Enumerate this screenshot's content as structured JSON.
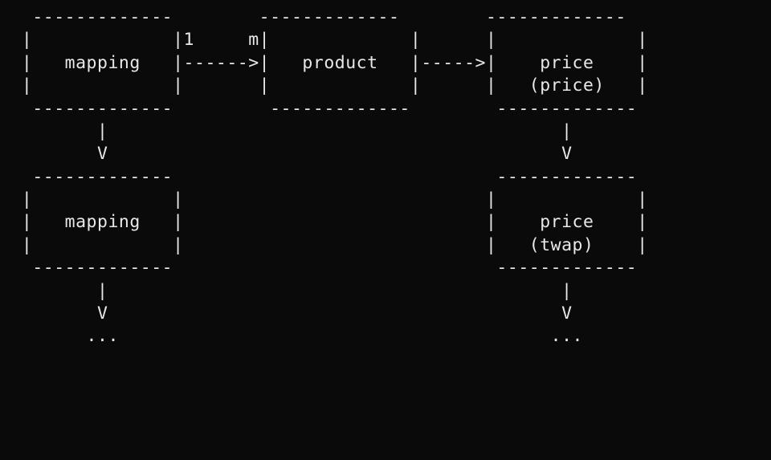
{
  "diagram": {
    "lines": [
      "   -------------        -------------        -------------",
      "  |             |1     m|             |      |             |",
      "  |   mapping   |------>|   product   |----->|    price    |",
      "  |             |       |             |      |   (price)   |",
      "   -------------         -------------        -------------",
      "         |                                          |",
      "         V                                          V",
      "   -------------                              -------------",
      "  |             |                            |             |",
      "  |   mapping   |                            |    price    |",
      "  |             |                            |   (twap)    |",
      "   -------------                              -------------",
      "         |                                          |",
      "         V                                          V",
      "        ...                                        ..."
    ],
    "entities": {
      "left_top": {
        "label": "mapping"
      },
      "left_bottom": {
        "label": "mapping"
      },
      "center": {
        "label": "product"
      },
      "right_top": {
        "label": "price",
        "subtype": "price"
      },
      "right_bottom": {
        "label": "price",
        "subtype": "twap"
      }
    },
    "relations": [
      {
        "from": "mapping",
        "to": "product",
        "cardinality_from": "1",
        "cardinality_to": "m"
      },
      {
        "from": "product",
        "to": "price"
      },
      {
        "from": "mapping",
        "to": "mapping",
        "direction": "down",
        "continues": true
      },
      {
        "from": "price",
        "to": "price",
        "direction": "down",
        "continues": true
      }
    ]
  }
}
